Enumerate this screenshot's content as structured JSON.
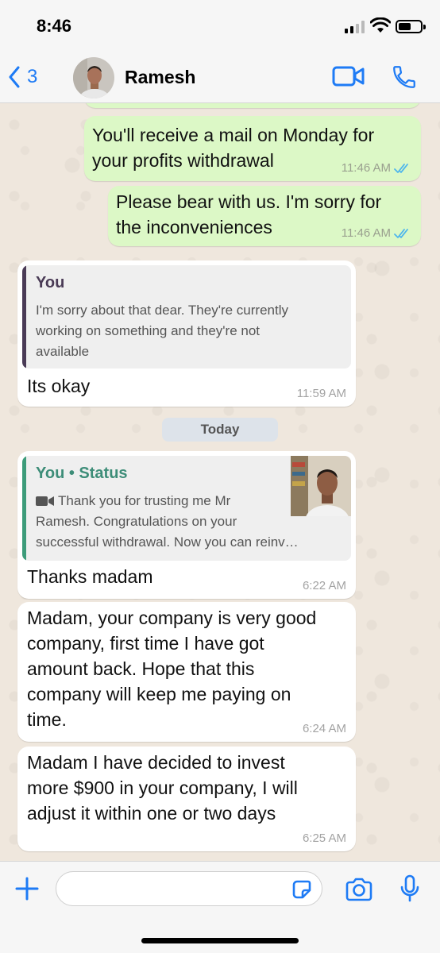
{
  "status_bar": {
    "time": "8:46"
  },
  "header": {
    "back_count": "3",
    "contact_name": "Ramesh"
  },
  "messages": [
    {
      "text_line1": "You'll receive a mail on Monday for",
      "text_line2": "your profits withdrawal",
      "time": "11:46 AM"
    },
    {
      "text_line1": "Please bear with us. I'm sorry for",
      "text_line2": "the inconveniences",
      "time": "11:46 AM"
    },
    {
      "quote_author": "You",
      "quote_line1": "I'm sorry about that dear. They're currently",
      "quote_line2": "working on something and they're not",
      "quote_line3": "available",
      "text": "Its okay",
      "time": "11:59 AM"
    },
    {
      "quote_author": "You • Status",
      "quote_line1": "Thank you for trusting me Mr",
      "quote_line2": "Ramesh. Congratulations on your",
      "quote_line3": "successful withdrawal. Now you can reinv…",
      "text": "Thanks madam",
      "time": "6:22 AM"
    },
    {
      "text_line1": "Madam, your company is very good",
      "text_line2": "company, first time I have got",
      "text_line3": "amount back. Hope that this",
      "text_line4": "company will keep me paying on",
      "text_line5": "time.",
      "time": "6:24 AM"
    },
    {
      "text_line1": "Madam I have decided to invest",
      "text_line2": "more $900 in your company, I will",
      "text_line3": "adjust it within one or two days",
      "time": "6:25 AM"
    }
  ],
  "day_divider": "Today",
  "input": {
    "placeholder": ""
  },
  "colors": {
    "accent": "#1e7bf5",
    "outgoing_bubble": "#dcf8c6",
    "incoming_bubble": "#ffffff",
    "read_tick": "#4fb6ec",
    "quote_bar_you": "#4a3b56",
    "quote_bar_status": "#3d9c7a",
    "status_author": "#3d8d78"
  },
  "icons": [
    "back-chevron-icon",
    "video-call-icon",
    "phone-icon",
    "double-check-icon",
    "video-camera-icon",
    "plus-icon",
    "sticker-icon",
    "camera-icon",
    "microphone-icon"
  ]
}
